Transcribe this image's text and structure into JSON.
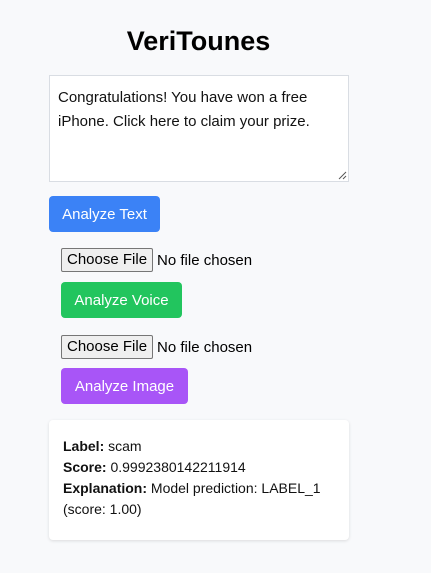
{
  "app": {
    "title": "VeriTounes"
  },
  "text_input": {
    "value": "Congratulations! You have won a free iPhone. Click here to claim your prize."
  },
  "buttons": {
    "analyze_text": "Analyze Text",
    "analyze_voice": "Analyze Voice",
    "analyze_image": "Analyze Image"
  },
  "voice_file": {
    "button_label": "Choose File",
    "status": "No file chosen"
  },
  "image_file": {
    "button_label": "Choose File",
    "status": "No file chosen"
  },
  "result": {
    "label_key": "Label:",
    "label_value": "scam",
    "score_key": "Score:",
    "score_value": "0.9992380142211914",
    "explanation_key": "Explanation:",
    "explanation_value": "Model prediction: LABEL_1 (score: 1.00)"
  },
  "colors": {
    "text_button": "#3b82f6",
    "voice_button": "#22c55e",
    "image_button": "#a855f7"
  }
}
